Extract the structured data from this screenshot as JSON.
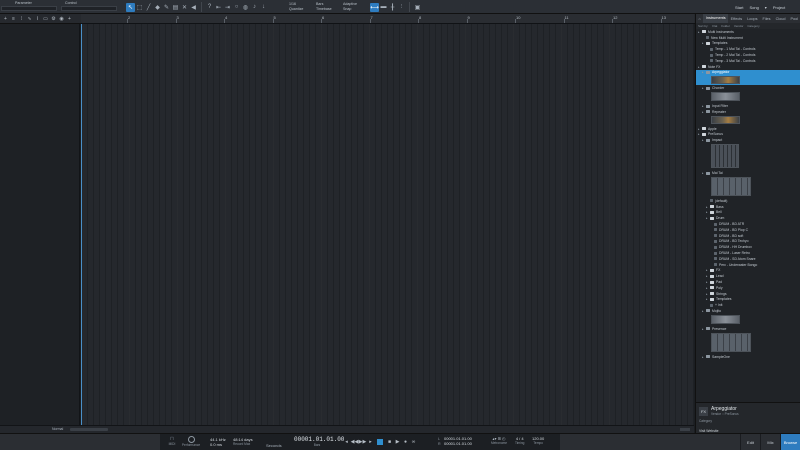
{
  "toolbar": {
    "parameter_label": "Parameter",
    "control_label": "Control",
    "quantize_top": "1/16",
    "quantize_bottom": "Quantize",
    "timebase_top": "Bars",
    "timebase_bottom": "Timebase",
    "snap_top": "Adaptive",
    "snap_bottom": "Snap",
    "start": "Start",
    "song": "Song",
    "project": "Project"
  },
  "ruler": {
    "numbers": [
      "2",
      "3",
      "4",
      "5",
      "6",
      "7",
      "8",
      "9",
      "10",
      "11",
      "12",
      "13"
    ]
  },
  "arrange": {
    "bottom_mode": "Normal"
  },
  "transport": {
    "midi": "MIDI",
    "performance": "Performance",
    "sample_rate": "44.1 kHz",
    "latency": "0.0 ms",
    "record_days": "48:14 days",
    "record_max": "Record Max",
    "seconds": "Seconds",
    "time_display": "00001.01.01.00",
    "bars": "Bars",
    "loop_l": "00001.01.01.00",
    "loop_r": "00001.01.01.00",
    "metronome": "Metronome",
    "timing_value": "4 / 4",
    "timing": "Timing",
    "tempo_value": "120.00",
    "tempo": "Tempo",
    "edit": "Edit",
    "mix": "Mix",
    "browse": "Browse"
  },
  "browser": {
    "tabs": [
      "Instruments",
      "Effects",
      "Loops",
      "Files",
      "Cloud",
      "Pool"
    ],
    "subtabs": [
      "Sort by:",
      "Flat",
      "Folder",
      "Vendor",
      "Category"
    ],
    "items": [
      {
        "label": "Multi Instruments",
        "kind": "folder",
        "indent": 0,
        "sel": false
      },
      {
        "label": "New Multi Instrument",
        "kind": "item",
        "indent": 1,
        "sel": false
      },
      {
        "label": "Templates",
        "kind": "folder",
        "indent": 1,
        "sel": false
      },
      {
        "label": "Temp - 1 Mai Tai - Controls",
        "kind": "item",
        "indent": 2,
        "sel": false
      },
      {
        "label": "Temp - 2 Mai Tai - Controls",
        "kind": "item",
        "indent": 2,
        "sel": false
      },
      {
        "label": "Temp - 3 Mai Tai - Controls",
        "kind": "item",
        "indent": 2,
        "sel": false
      },
      {
        "label": "Note FX",
        "kind": "folder",
        "indent": 0,
        "sel": false
      },
      {
        "label": "Arpeggiator",
        "kind": "plugin",
        "indent": 1,
        "sel": true
      },
      {
        "label": "",
        "kind": "thumb",
        "indent": 1,
        "sel": true
      },
      {
        "label": "Chorder",
        "kind": "plugin",
        "indent": 1,
        "sel": false
      },
      {
        "label": "",
        "kind": "thumb-gray",
        "indent": 1,
        "sel": false
      },
      {
        "label": "Input Filter",
        "kind": "plugin",
        "indent": 1,
        "sel": false
      },
      {
        "label": "Repeater",
        "kind": "plugin",
        "indent": 1,
        "sel": false
      },
      {
        "label": "",
        "kind": "thumb",
        "indent": 1,
        "sel": false
      },
      {
        "label": "Apple",
        "kind": "folder",
        "indent": 0,
        "sel": false
      },
      {
        "label": "PreSonus",
        "kind": "folder",
        "indent": 0,
        "sel": false
      },
      {
        "label": "Impact",
        "kind": "plugin",
        "indent": 1,
        "sel": false
      },
      {
        "label": "",
        "kind": "thumb-sq",
        "indent": 1,
        "sel": false
      },
      {
        "label": "Mai Tai",
        "kind": "plugin",
        "indent": 1,
        "sel": false
      },
      {
        "label": "",
        "kind": "thumb-wide",
        "indent": 1,
        "sel": false
      },
      {
        "label": "(default)",
        "kind": "item",
        "indent": 2,
        "sel": false
      },
      {
        "label": "Bass",
        "kind": "folder",
        "indent": 2,
        "sel": false
      },
      {
        "label": "Bell",
        "kind": "folder",
        "indent": 2,
        "sel": false
      },
      {
        "label": "Drum",
        "kind": "folder",
        "indent": 2,
        "sel": false
      },
      {
        "label": "DRUM - BD ATR",
        "kind": "item",
        "indent": 3,
        "sel": false
      },
      {
        "label": "DRUM - BD Plop C",
        "kind": "item",
        "indent": 3,
        "sel": false
      },
      {
        "label": "DRUM - BD soft",
        "kind": "item",
        "indent": 3,
        "sel": false
      },
      {
        "label": "DRUM - BD Techyo",
        "kind": "item",
        "indent": 3,
        "sel": false
      },
      {
        "label": "DRUM - HH Drumbox",
        "kind": "item",
        "indent": 3,
        "sel": false
      },
      {
        "label": "DRUM - Laser Retro",
        "kind": "item",
        "indent": 3,
        "sel": false
      },
      {
        "label": "DRUM - SD Atom Snare",
        "kind": "item",
        "indent": 3,
        "sel": false
      },
      {
        "label": "Perc - Underwater Bongo",
        "kind": "item",
        "indent": 3,
        "sel": false
      },
      {
        "label": "FX",
        "kind": "folder",
        "indent": 2,
        "sel": false
      },
      {
        "label": "Lead",
        "kind": "folder",
        "indent": 2,
        "sel": false
      },
      {
        "label": "Pad",
        "kind": "folder",
        "indent": 2,
        "sel": false
      },
      {
        "label": "Poly",
        "kind": "folder",
        "indent": 2,
        "sel": false
      },
      {
        "label": "Strings",
        "kind": "folder",
        "indent": 2,
        "sel": false
      },
      {
        "label": "Templates",
        "kind": "folder",
        "indent": 2,
        "sel": false
      },
      {
        "label": "+ Init",
        "kind": "item",
        "indent": 2,
        "sel": false
      },
      {
        "label": "Mojito",
        "kind": "plugin",
        "indent": 1,
        "sel": false
      },
      {
        "label": "",
        "kind": "thumb-gray",
        "indent": 1,
        "sel": false
      },
      {
        "label": "Presence",
        "kind": "plugin",
        "indent": 1,
        "sel": false
      },
      {
        "label": "",
        "kind": "thumb-wide",
        "indent": 1,
        "sel": false
      },
      {
        "label": "SampleOne",
        "kind": "plugin",
        "indent": 1,
        "sel": false
      }
    ],
    "info": {
      "badge": "FX",
      "title": "Arpeggiator",
      "vendor": "Vendor :: PreSonus",
      "category": "Category",
      "link": "Visit Website"
    }
  }
}
